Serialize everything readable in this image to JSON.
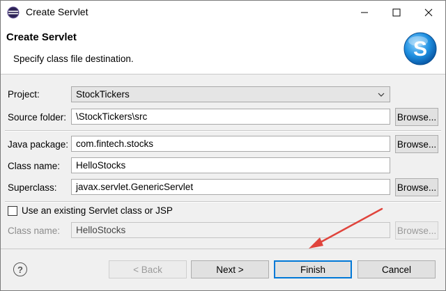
{
  "window": {
    "title": "Create Servlet",
    "icons": {
      "app": "eclipse-icon",
      "minimize": "minimize-icon",
      "maximize": "maximize-icon",
      "close": "close-icon"
    }
  },
  "banner": {
    "title": "Create Servlet",
    "description": "Specify class file destination.",
    "logo_letter": "S"
  },
  "form": {
    "project": {
      "label": "Project:",
      "value": "StockTickers"
    },
    "source_folder": {
      "label": "Source folder:",
      "value": "\\StockTickers\\src",
      "browse": "Browse..."
    },
    "java_package": {
      "label": "Java package:",
      "value": "com.fintech.stocks",
      "browse": "Browse..."
    },
    "class_name": {
      "label": "Class name:",
      "value": "HelloStocks"
    },
    "superclass": {
      "label": "Superclass:",
      "value": "javax.servlet.GenericServlet",
      "browse": "Browse..."
    },
    "use_existing": {
      "label": "Use an existing Servlet class or JSP",
      "checked": false
    },
    "existing_class_name": {
      "label": "Class name:",
      "value": "HelloStocks",
      "browse": "Browse..."
    }
  },
  "footer": {
    "help": "?",
    "back": "< Back",
    "next": "Next >",
    "finish": "Finish",
    "cancel": "Cancel"
  },
  "annotation": {
    "arrow_color": "#e0443c"
  }
}
